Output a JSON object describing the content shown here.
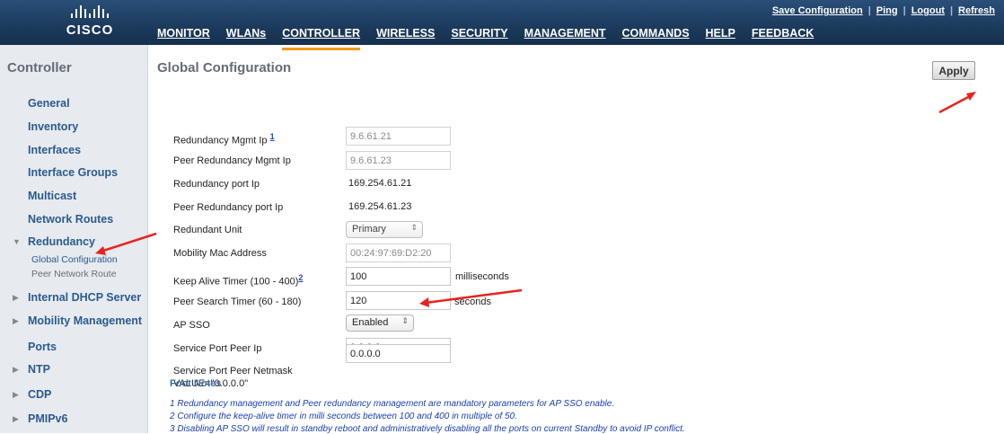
{
  "brand": {
    "name": "CISCO"
  },
  "menu": [
    {
      "label": "MONITOR",
      "active": false
    },
    {
      "label": "WLANs",
      "active": false
    },
    {
      "label": "CONTROLLER",
      "active": true
    },
    {
      "label": "WIRELESS",
      "active": false
    },
    {
      "label": "SECURITY",
      "active": false
    },
    {
      "label": "MANAGEMENT",
      "active": false
    },
    {
      "label": "COMMANDS",
      "active": false
    },
    {
      "label": "HELP",
      "active": false
    },
    {
      "label": "FEEDBACK",
      "active": false
    }
  ],
  "toplinks": {
    "save": "Save Configuration",
    "ping": "Ping",
    "logout": "Logout",
    "refresh": "Refresh"
  },
  "sidebar": {
    "title": "Controller",
    "items": {
      "general": "General",
      "inventory": "Inventory",
      "interfaces": "Interfaces",
      "interface_groups": "Interface Groups",
      "multicast": "Multicast",
      "network_routes": "Network Routes",
      "redundancy": "Redundancy",
      "global_configuration": "Global Configuration",
      "peer_network_route": "Peer Network Route",
      "internal_dhcp_server": "Internal DHCP Server",
      "mobility_management": "Mobility Management",
      "ports": "Ports",
      "ntp": "NTP",
      "cdp": "CDP",
      "pmipv6": "PMIPv6"
    }
  },
  "page": {
    "title": "Global Configuration",
    "apply_label": "Apply"
  },
  "form": {
    "redundancy_mgmt_ip": {
      "label": "Redundancy Mgmt Ip",
      "note": "1",
      "value": "9.6.61.21"
    },
    "peer_redundancy_mgmt_ip": {
      "label": "Peer Redundancy Mgmt Ip",
      "value": "9.6.61.23"
    },
    "redundancy_port_ip": {
      "label": "Redundancy port Ip",
      "value": "169.254.61.21"
    },
    "peer_redundancy_port_ip": {
      "label": "Peer Redundancy port Ip",
      "value": "169.254.61.23"
    },
    "redundant_unit": {
      "label": "Redundant Unit",
      "value": "Primary"
    },
    "mobility_mac": {
      "label": "Mobility Mac Address",
      "value": "00:24:97:69:D2:20"
    },
    "keep_alive": {
      "label": "Keep Alive Timer (100 - 400)",
      "note": "2",
      "value": "100",
      "unit": "milliseconds"
    },
    "peer_search": {
      "label": "Peer Search Timer (60 - 180)",
      "value": "120",
      "unit": "seconds"
    },
    "ap_sso": {
      "label": "AP SSO",
      "value": "Enabled"
    },
    "service_port_peer_ip": {
      "label": "Service Port Peer Ip",
      "value": "0.0.0.0"
    },
    "service_port_peer_netmask": {
      "label_line1": "Service Port Peer Netmask",
      "label_line2": "VALUE=\"0.0.0.0\"",
      "value": "0.0.0.0"
    }
  },
  "footnotes": {
    "title": "Foot Notes",
    "items": [
      "1 Redundancy management and Peer redundancy management are mandatory parameters for AP SSO enable.",
      "2 Configure the keep-alive timer in milli seconds between 100 and 400 in multiple of 50.",
      "3 Disabling AP SSO will result in standby reboot and administratively disabling all the ports on current Standby to avoid IP conflict."
    ]
  },
  "annotation_color": "#e8231f"
}
